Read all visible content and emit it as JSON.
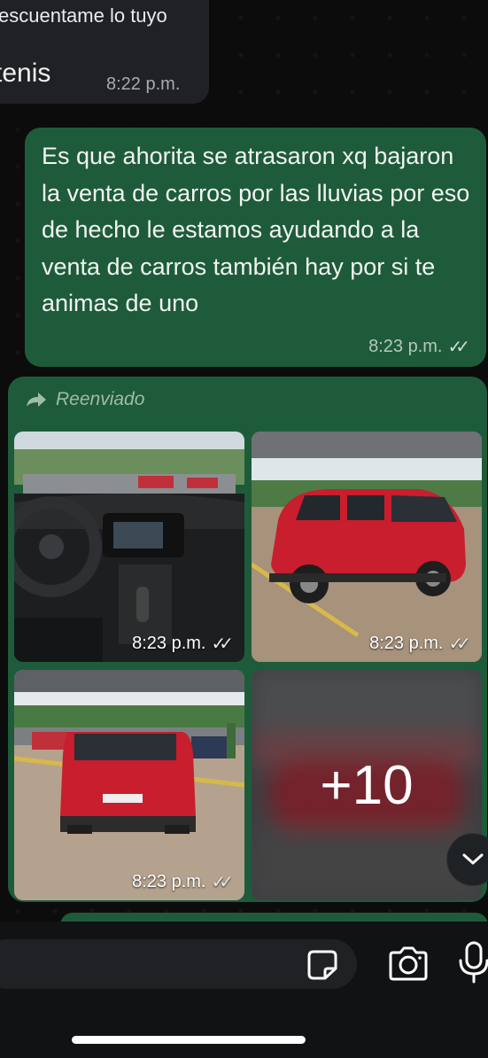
{
  "incoming_message": {
    "line1": "escuentame lo tuyo",
    "line2": "tenis",
    "time": "8:22 p.m."
  },
  "outgoing_message": {
    "text": "Es que ahorita se atrasaron xq bajaron la venta de carros por las lluvias por eso de hecho le estamos ayudando a la venta de carros también hay por si te animas de uno",
    "time": "8:23 p.m.",
    "status": "✓✓"
  },
  "forwarded_album": {
    "label": "Reenviado",
    "photos": [
      {
        "description": "car-interior-dashboard",
        "time": "8:23 p.m.",
        "status": "✓✓"
      },
      {
        "description": "red-suv-side-rear",
        "time": "8:23 p.m.",
        "status": "✓✓"
      },
      {
        "description": "red-suv-rear",
        "time": "8:23 p.m.",
        "status": "✓✓"
      }
    ],
    "more_count": "+10"
  },
  "colors": {
    "background": "#0c0c0c",
    "outgoing_bubble": "#1e5b3a",
    "incoming_bubble": "#1f2124"
  },
  "icons": {
    "forward": "forward-arrow-icon",
    "scroll_down": "chevron-down-icon",
    "sticker": "sticker-icon",
    "camera": "camera-icon",
    "mic": "microphone-icon"
  }
}
